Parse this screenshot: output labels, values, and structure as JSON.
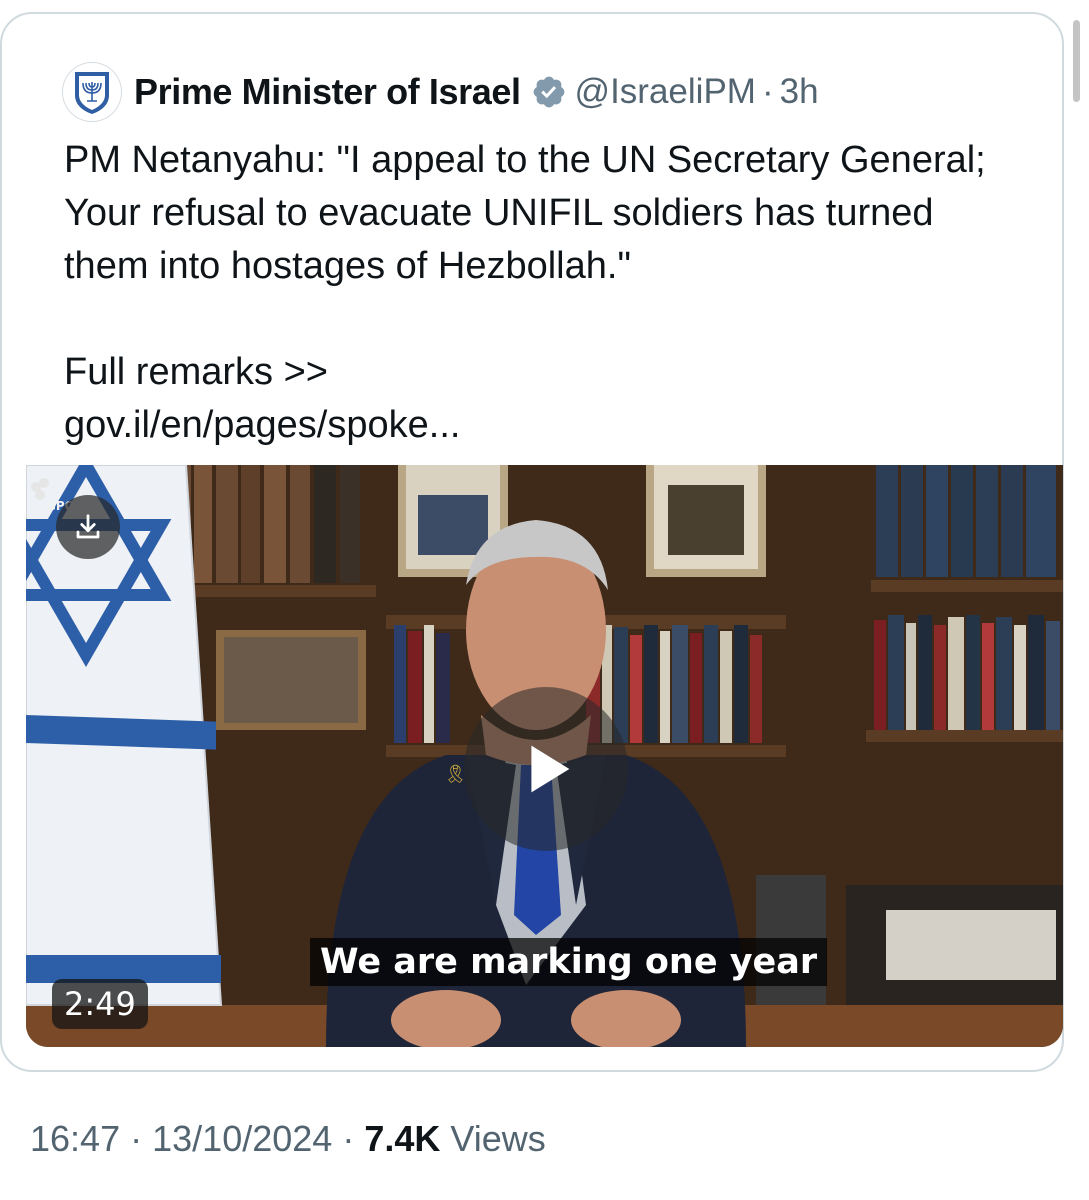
{
  "tweet": {
    "author_name": "Prime Minister of Israel",
    "author_handle": "@IsraeliPM",
    "separator": "·",
    "age": "3h",
    "avatar_icon": "israel-emblem-icon",
    "verified_icon": "verified-badge-icon",
    "verified_color": "#829aab",
    "text": "PM Netanyahu: \"I appeal to the UN Secretary General; Your refusal to evacuate UNIFIL soldiers has turned them into hostages of Hezbollah.\"\n\nFull remarks >>\ngov.il/en/pages/spoke..."
  },
  "video": {
    "watermark": "GPO",
    "download_icon": "download-icon",
    "play_icon": "play-icon",
    "caption": "We are marking one year",
    "duration": "2:49"
  },
  "meta": {
    "time": "16:47",
    "date": "13/10/2024",
    "separator": "·",
    "views_count": "7.4K",
    "views_label": "Views"
  },
  "colors": {
    "text_primary": "#0f1419",
    "text_secondary": "#536471",
    "border": "#cfd9de",
    "flag_blue": "#2d5fa8"
  }
}
